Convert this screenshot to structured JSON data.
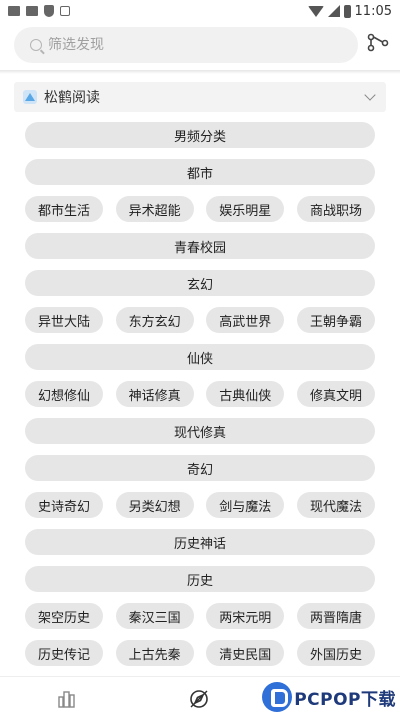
{
  "status_bar": {
    "time": "11:05"
  },
  "search": {
    "placeholder": "筛选发现"
  },
  "source": {
    "name": "松鹤阅读"
  },
  "categories": {
    "male": "男频分类",
    "urban": "都市",
    "urban_items": [
      "都市生活",
      "异术超能",
      "娱乐明星",
      "商战职场"
    ],
    "youth": "青春校园",
    "xuanhuan": "玄幻",
    "xuanhuan_items": [
      "异世大陆",
      "东方玄幻",
      "高武世界",
      "王朝争霸"
    ],
    "xianxia": "仙侠",
    "xianxia_items": [
      "幻想修仙",
      "神话修真",
      "古典仙侠",
      "修真文明"
    ],
    "modern_xiuzhen": "现代修真",
    "fantasy": "奇幻",
    "fantasy_items": [
      "史诗奇幻",
      "另类幻想",
      "剑与魔法",
      "现代魔法"
    ],
    "history_myth": "历史神话",
    "history": "历史",
    "history_items_1": [
      "架空历史",
      "秦汉三国",
      "两宋元明",
      "两晋隋唐"
    ],
    "history_items_2": [
      "历史传记",
      "上古先秦",
      "清史民国",
      "外国历史"
    ]
  },
  "watermark": {
    "text": "PCPOP下载"
  },
  "icons": {
    "search": "search-icon",
    "share": "share-nodes-icon",
    "source_logo": "app-logo-icon",
    "expand": "chevron-down-icon",
    "nav_bookshelf": "bookshelf-icon",
    "nav_discover": "compass-icon"
  }
}
